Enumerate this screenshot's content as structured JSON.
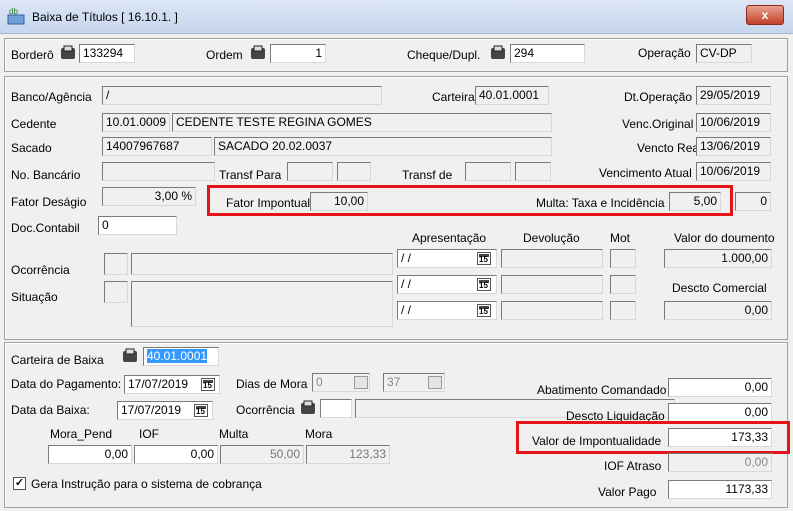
{
  "window": {
    "title": "Baixa de Títulos [ 16.10.1. ]",
    "close": "x"
  },
  "header": {
    "bordero_label": "Borderô",
    "bordero_value": "133294",
    "ordem_label": "Ordem",
    "ordem_value": "1",
    "cheque_label": "Cheque/Dupl.",
    "cheque_value": "294",
    "operacao_label": "Operação",
    "operacao_value": "CV-DP"
  },
  "titulo": {
    "banco_label": "Banco/Agência",
    "banco_value": "/",
    "carteira_label": "Carteira",
    "carteira_value": "40.01.0001",
    "dtop_label": "Dt.Operação",
    "dtop_value": "29/05/2019",
    "cedente_label": "Cedente",
    "cedente_code": "10.01.0009",
    "cedente_name": "CEDENTE TESTE REGINA GOMES",
    "vencorig_label": "Venc.Original",
    "vencorig_value": "10/06/2019",
    "sacado_label": "Sacado",
    "sacado_code": "14007967687",
    "sacado_name": "SACADO 20.02.0037",
    "vencreal_label": "Vencto Real",
    "vencreal_value": "13/06/2019",
    "nobancario_label": "No. Bancário",
    "transfpara_label": "Transf Para",
    "transfde_label": "Transf de",
    "vencatual_label": "Vencimento Atual",
    "vencatual_value": "10/06/2019",
    "fatordes_label": "Fator Deságio",
    "fatordes_value": "3,00 %",
    "fatorimp_label": "Fator Impontual",
    "fatorimp_value": "10,00",
    "multa_label": "Multa: Taxa e Incidência",
    "multa_taxa": "5,00",
    "multa_inc": "0",
    "doccont_label": "Doc.Contabil",
    "doccont_value": "0",
    "apresentacao_label": "Apresentação",
    "devolucao_label": "Devolução",
    "mot_label": "Mot",
    "valordoc_label": "Valor do doumento",
    "valordoc_value": "1.000,00",
    "ocorrencia_label": "Ocorrência",
    "situacao_label": "Situação",
    "date_blank": "/ /",
    "descto_label": "Descto Comercial",
    "descto_value": "0,00"
  },
  "baixa": {
    "carteira_label": "Carteira de Baixa",
    "carteira_value": "40.01.0001",
    "dtpag_label": "Data do Pagamento:",
    "dtpag_value": "17/07/2019",
    "diasmora_label": "Dias de Mora",
    "diasmora_a": "0",
    "diasmora_b": "37",
    "dtbaixa_label": "Data da Baixa:",
    "dtbaixa_value": "17/07/2019",
    "ocorrencia_label": "Ocorrência",
    "abat_label": "Abatimento Comandado",
    "abat_value": "0,00",
    "descliq_label": "Descto Liquidação",
    "descliq_value": "0,00",
    "moraPend_label": "Mora_Pend",
    "moraPend_value": "0,00",
    "iof_label": "IOF",
    "iof_value": "0,00",
    "multa_label": "Multa",
    "multa_value": "50,00",
    "mora_label": "Mora",
    "mora_value": "123,33",
    "valimp_label": "Valor de Impontualidade",
    "valimp_value": "173,33",
    "iofatraso_label": "IOF Atraso",
    "iofatraso_value": "0,00",
    "gera_label": "Gera Instrução para o sistema de cobrança",
    "gera_check": "✓",
    "valorpago_label": "Valor Pago",
    "valorpago_value": "1173,33"
  },
  "colors": {
    "highlight": "#E2151B",
    "selection": "#3399FF"
  }
}
